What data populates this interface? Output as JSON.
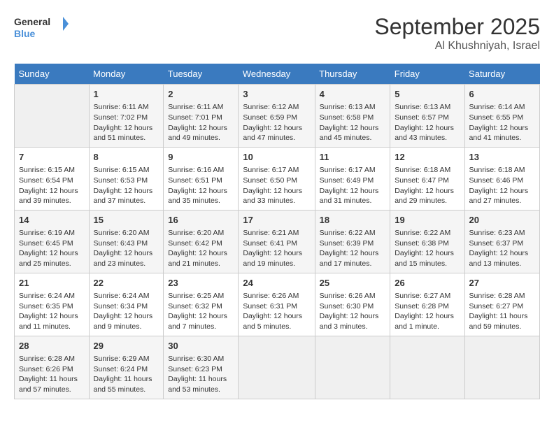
{
  "header": {
    "logo_general": "General",
    "logo_blue": "Blue",
    "month": "September 2025",
    "location": "Al Khushniyah, Israel"
  },
  "days_of_week": [
    "Sunday",
    "Monday",
    "Tuesday",
    "Wednesday",
    "Thursday",
    "Friday",
    "Saturday"
  ],
  "weeks": [
    [
      {
        "day": "",
        "info": ""
      },
      {
        "day": "1",
        "info": "Sunrise: 6:11 AM\nSunset: 7:02 PM\nDaylight: 12 hours and 51 minutes."
      },
      {
        "day": "2",
        "info": "Sunrise: 6:11 AM\nSunset: 7:01 PM\nDaylight: 12 hours and 49 minutes."
      },
      {
        "day": "3",
        "info": "Sunrise: 6:12 AM\nSunset: 6:59 PM\nDaylight: 12 hours and 47 minutes."
      },
      {
        "day": "4",
        "info": "Sunrise: 6:13 AM\nSunset: 6:58 PM\nDaylight: 12 hours and 45 minutes."
      },
      {
        "day": "5",
        "info": "Sunrise: 6:13 AM\nSunset: 6:57 PM\nDaylight: 12 hours and 43 minutes."
      },
      {
        "day": "6",
        "info": "Sunrise: 6:14 AM\nSunset: 6:55 PM\nDaylight: 12 hours and 41 minutes."
      }
    ],
    [
      {
        "day": "7",
        "info": "Sunrise: 6:15 AM\nSunset: 6:54 PM\nDaylight: 12 hours and 39 minutes."
      },
      {
        "day": "8",
        "info": "Sunrise: 6:15 AM\nSunset: 6:53 PM\nDaylight: 12 hours and 37 minutes."
      },
      {
        "day": "9",
        "info": "Sunrise: 6:16 AM\nSunset: 6:51 PM\nDaylight: 12 hours and 35 minutes."
      },
      {
        "day": "10",
        "info": "Sunrise: 6:17 AM\nSunset: 6:50 PM\nDaylight: 12 hours and 33 minutes."
      },
      {
        "day": "11",
        "info": "Sunrise: 6:17 AM\nSunset: 6:49 PM\nDaylight: 12 hours and 31 minutes."
      },
      {
        "day": "12",
        "info": "Sunrise: 6:18 AM\nSunset: 6:47 PM\nDaylight: 12 hours and 29 minutes."
      },
      {
        "day": "13",
        "info": "Sunrise: 6:18 AM\nSunset: 6:46 PM\nDaylight: 12 hours and 27 minutes."
      }
    ],
    [
      {
        "day": "14",
        "info": "Sunrise: 6:19 AM\nSunset: 6:45 PM\nDaylight: 12 hours and 25 minutes."
      },
      {
        "day": "15",
        "info": "Sunrise: 6:20 AM\nSunset: 6:43 PM\nDaylight: 12 hours and 23 minutes."
      },
      {
        "day": "16",
        "info": "Sunrise: 6:20 AM\nSunset: 6:42 PM\nDaylight: 12 hours and 21 minutes."
      },
      {
        "day": "17",
        "info": "Sunrise: 6:21 AM\nSunset: 6:41 PM\nDaylight: 12 hours and 19 minutes."
      },
      {
        "day": "18",
        "info": "Sunrise: 6:22 AM\nSunset: 6:39 PM\nDaylight: 12 hours and 17 minutes."
      },
      {
        "day": "19",
        "info": "Sunrise: 6:22 AM\nSunset: 6:38 PM\nDaylight: 12 hours and 15 minutes."
      },
      {
        "day": "20",
        "info": "Sunrise: 6:23 AM\nSunset: 6:37 PM\nDaylight: 12 hours and 13 minutes."
      }
    ],
    [
      {
        "day": "21",
        "info": "Sunrise: 6:24 AM\nSunset: 6:35 PM\nDaylight: 12 hours and 11 minutes."
      },
      {
        "day": "22",
        "info": "Sunrise: 6:24 AM\nSunset: 6:34 PM\nDaylight: 12 hours and 9 minutes."
      },
      {
        "day": "23",
        "info": "Sunrise: 6:25 AM\nSunset: 6:32 PM\nDaylight: 12 hours and 7 minutes."
      },
      {
        "day": "24",
        "info": "Sunrise: 6:26 AM\nSunset: 6:31 PM\nDaylight: 12 hours and 5 minutes."
      },
      {
        "day": "25",
        "info": "Sunrise: 6:26 AM\nSunset: 6:30 PM\nDaylight: 12 hours and 3 minutes."
      },
      {
        "day": "26",
        "info": "Sunrise: 6:27 AM\nSunset: 6:28 PM\nDaylight: 12 hours and 1 minute."
      },
      {
        "day": "27",
        "info": "Sunrise: 6:28 AM\nSunset: 6:27 PM\nDaylight: 11 hours and 59 minutes."
      }
    ],
    [
      {
        "day": "28",
        "info": "Sunrise: 6:28 AM\nSunset: 6:26 PM\nDaylight: 11 hours and 57 minutes."
      },
      {
        "day": "29",
        "info": "Sunrise: 6:29 AM\nSunset: 6:24 PM\nDaylight: 11 hours and 55 minutes."
      },
      {
        "day": "30",
        "info": "Sunrise: 6:30 AM\nSunset: 6:23 PM\nDaylight: 11 hours and 53 minutes."
      },
      {
        "day": "",
        "info": ""
      },
      {
        "day": "",
        "info": ""
      },
      {
        "day": "",
        "info": ""
      },
      {
        "day": "",
        "info": ""
      }
    ]
  ]
}
